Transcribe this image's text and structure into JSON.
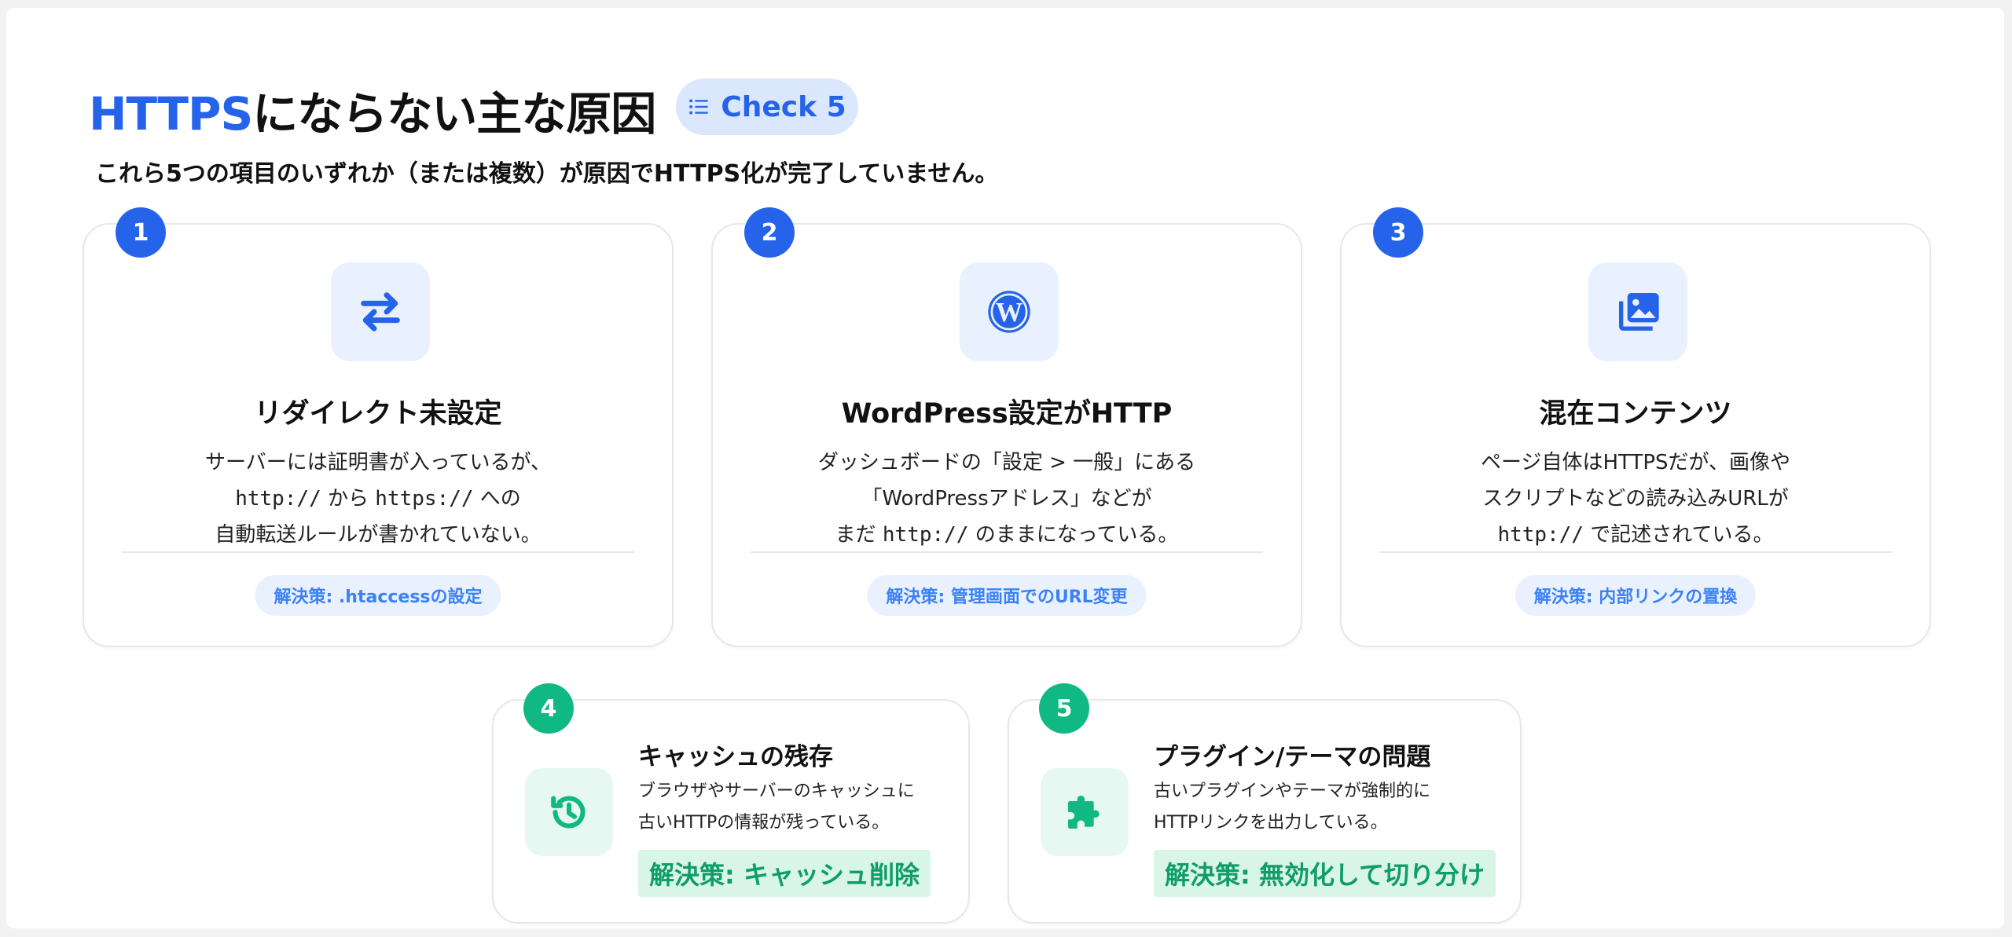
{
  "header": {
    "title_accent": "HTTPS",
    "title_rest": "にならない主な原因",
    "badge_label": "Check 5",
    "subtitle": "これら5つの項目のいずれか（または複数）が原因でHTTPS化が完了していません。"
  },
  "cards": [
    {
      "number": "1",
      "icon": "swap-arrows-icon",
      "title": "リダイレクト未設定",
      "desc_line1": "サーバーには証明書が入っているが、",
      "desc_line2_code_a": "http://",
      "desc_line2_mid": " から ",
      "desc_line2_code_b": "https://",
      "desc_line2_end": " への",
      "desc_line3": "自動転送ルールが書かれていない。",
      "solution": "解決策: .htaccessの設定"
    },
    {
      "number": "2",
      "icon": "wordpress-icon",
      "title": "WordPress設定がHTTP",
      "desc_line1": "ダッシュボードの「設定 > 一般」にある",
      "desc_line2": "「WordPressアドレス」などが",
      "desc_line3_pre": "まだ ",
      "desc_line3_code": "http://",
      "desc_line3_end": " のままになっている。",
      "solution": "解決策: 管理画面でのURL変更"
    },
    {
      "number": "3",
      "icon": "image-stack-icon",
      "title": "混在コンテンツ",
      "desc_line1": "ページ自体はHTTPSだが、画像や",
      "desc_line2": "スクリプトなどの読み込みURLが",
      "desc_line3_code": "http://",
      "desc_line3_end": " で記述されている。",
      "solution": "解決策: 内部リンクの置換"
    },
    {
      "number": "4",
      "icon": "history-icon",
      "title": "キャッシュの残存",
      "desc_line1": "ブラウザやサーバーのキャッシュに",
      "desc_line2": "古いHTTPの情報が残っている。",
      "solution": "解決策: キャッシュ削除"
    },
    {
      "number": "5",
      "icon": "puzzle-icon",
      "title": "プラグイン/テーマの問題",
      "desc_line1": "古いプラグインやテーマが強制的に",
      "desc_line2": "HTTPリンクを出力している。",
      "solution": "解決策: 無効化して切り分け"
    }
  ],
  "colors": {
    "accent_blue": "#2563eb",
    "accent_green": "#10b981",
    "solution_blue_bg": "#eaf1fe",
    "solution_green_bg": "#d8f5e8"
  }
}
